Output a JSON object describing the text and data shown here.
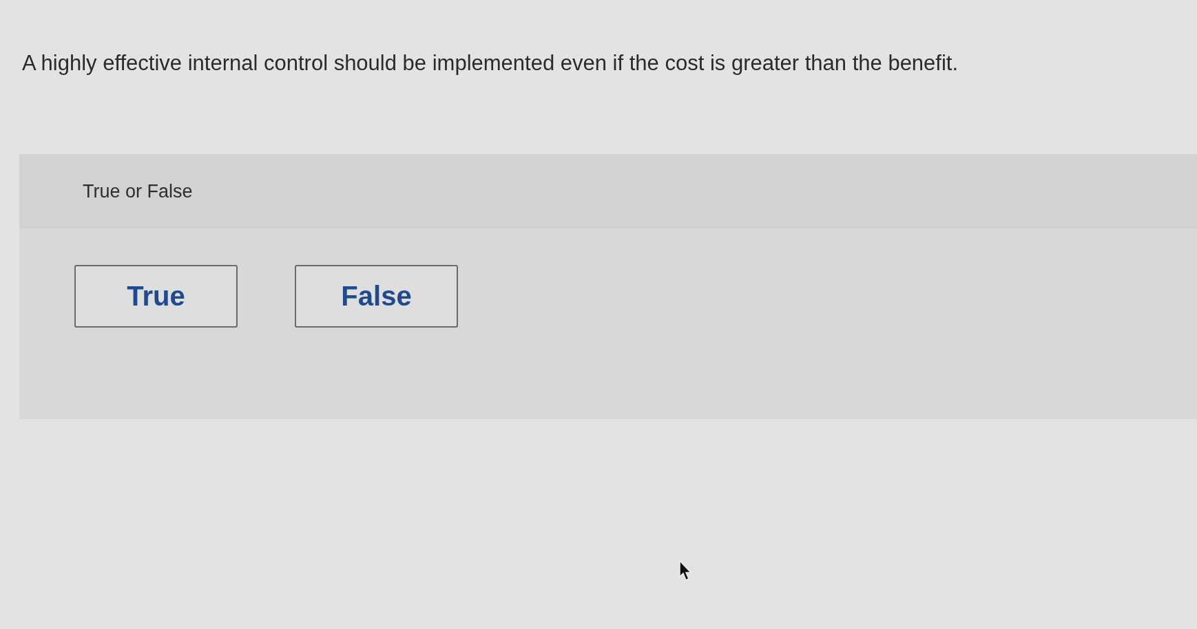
{
  "question": "A highly effective internal control should be implemented even if the cost is greater than the benefit.",
  "answer_panel": {
    "heading": "True or False",
    "options": [
      {
        "label": "True",
        "selected": false
      },
      {
        "label": "False",
        "selected": false
      }
    ]
  }
}
